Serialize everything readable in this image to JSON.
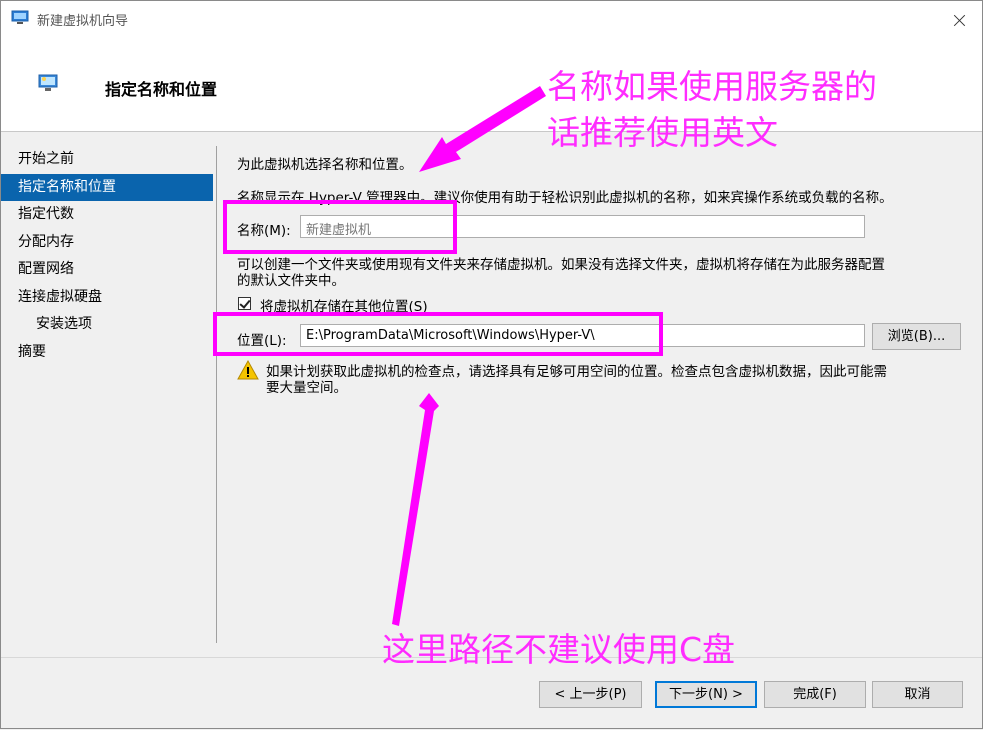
{
  "window": {
    "title": "新建虚拟机向导",
    "header_title": "指定名称和位置"
  },
  "nav": {
    "items": [
      {
        "label": "开始之前"
      },
      {
        "label": "指定名称和位置"
      },
      {
        "label": "指定代数"
      },
      {
        "label": "分配内存"
      },
      {
        "label": "配置网络"
      },
      {
        "label": "连接虚拟硬盘"
      },
      {
        "label": "安装选项"
      },
      {
        "label": "摘要"
      }
    ],
    "active_index": 1
  },
  "content": {
    "heading": "为此虚拟机选择名称和位置。",
    "description": "名称显示在 Hyper-V 管理器中。建议你使用有助于轻松识别此虚拟机的名称，如来宾操作系统或负载的名称。",
    "name_label": "名称(M):",
    "name_placeholder": "新建虚拟机",
    "folder_desc_line1": "可以创建一个文件夹或使用现有文件夹来存储虚拟机。如果没有选择文件夹，虚拟机将存储在为此服务器配置",
    "folder_desc_line2": "的默认文件夹中。",
    "store_checkbox_label": "将虚拟机存储在其他位置(S)",
    "store_checkbox_checked": true,
    "location_label": "位置(L):",
    "location_value": "E:\\ProgramData\\Microsoft\\Windows\\Hyper-V\\",
    "browse_label": "浏览(B)...",
    "warning_line1": "如果计划获取此虚拟机的检查点，请选择具有足够可用空间的位置。检查点包含虚拟机数据，因此可能需",
    "warning_line2": "要大量空间。"
  },
  "footer": {
    "prev_label": "< 上一步(P)",
    "next_label": "下一步(N) >",
    "finish_label": "完成(F)",
    "cancel_label": "取消"
  },
  "annotations": {
    "top_note_line1": "名称如果使用服务器的",
    "top_note_line2": "话推荐使用英文",
    "bottom_note": "这里路径不建议使用C盘",
    "color": "#ff00ff"
  },
  "colors": {
    "nav_active": "#0a64ad",
    "default_button_border": "#0078d7"
  }
}
